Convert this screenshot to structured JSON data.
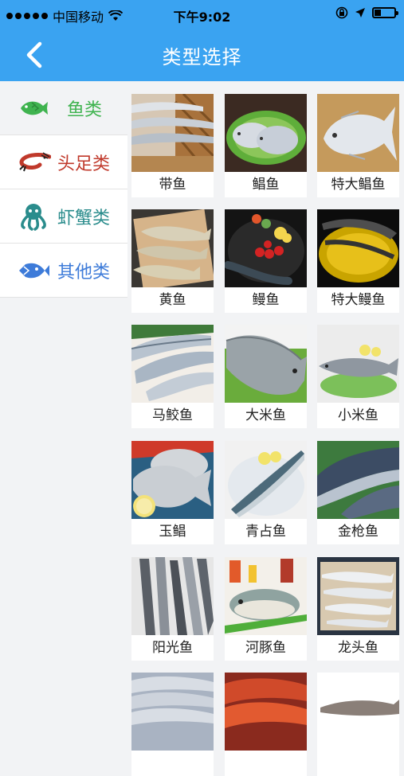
{
  "status": {
    "carrier": "中国移动",
    "time": "下午9:02"
  },
  "nav": {
    "title": "类型选择"
  },
  "sidebar": {
    "items": [
      {
        "label": "鱼类",
        "color": "#3fb34f"
      },
      {
        "label": "头足类",
        "color": "#c0392b"
      },
      {
        "label": "虾蟹类",
        "color": "#2a8c8c"
      },
      {
        "label": "其他类",
        "color": "#3d7bd9"
      }
    ]
  },
  "grid": {
    "items": [
      {
        "label": "带鱼"
      },
      {
        "label": "鲳鱼"
      },
      {
        "label": "特大鲳鱼"
      },
      {
        "label": "黄鱼"
      },
      {
        "label": "鳗鱼"
      },
      {
        "label": "特大鳗鱼"
      },
      {
        "label": "马鲛鱼"
      },
      {
        "label": "大米鱼"
      },
      {
        "label": "小米鱼"
      },
      {
        "label": "玉鲳"
      },
      {
        "label": "青占鱼"
      },
      {
        "label": "金枪鱼"
      },
      {
        "label": "阳光鱼"
      },
      {
        "label": "河豚鱼"
      },
      {
        "label": "龙头鱼"
      },
      {
        "label": ""
      },
      {
        "label": ""
      },
      {
        "label": ""
      }
    ]
  }
}
